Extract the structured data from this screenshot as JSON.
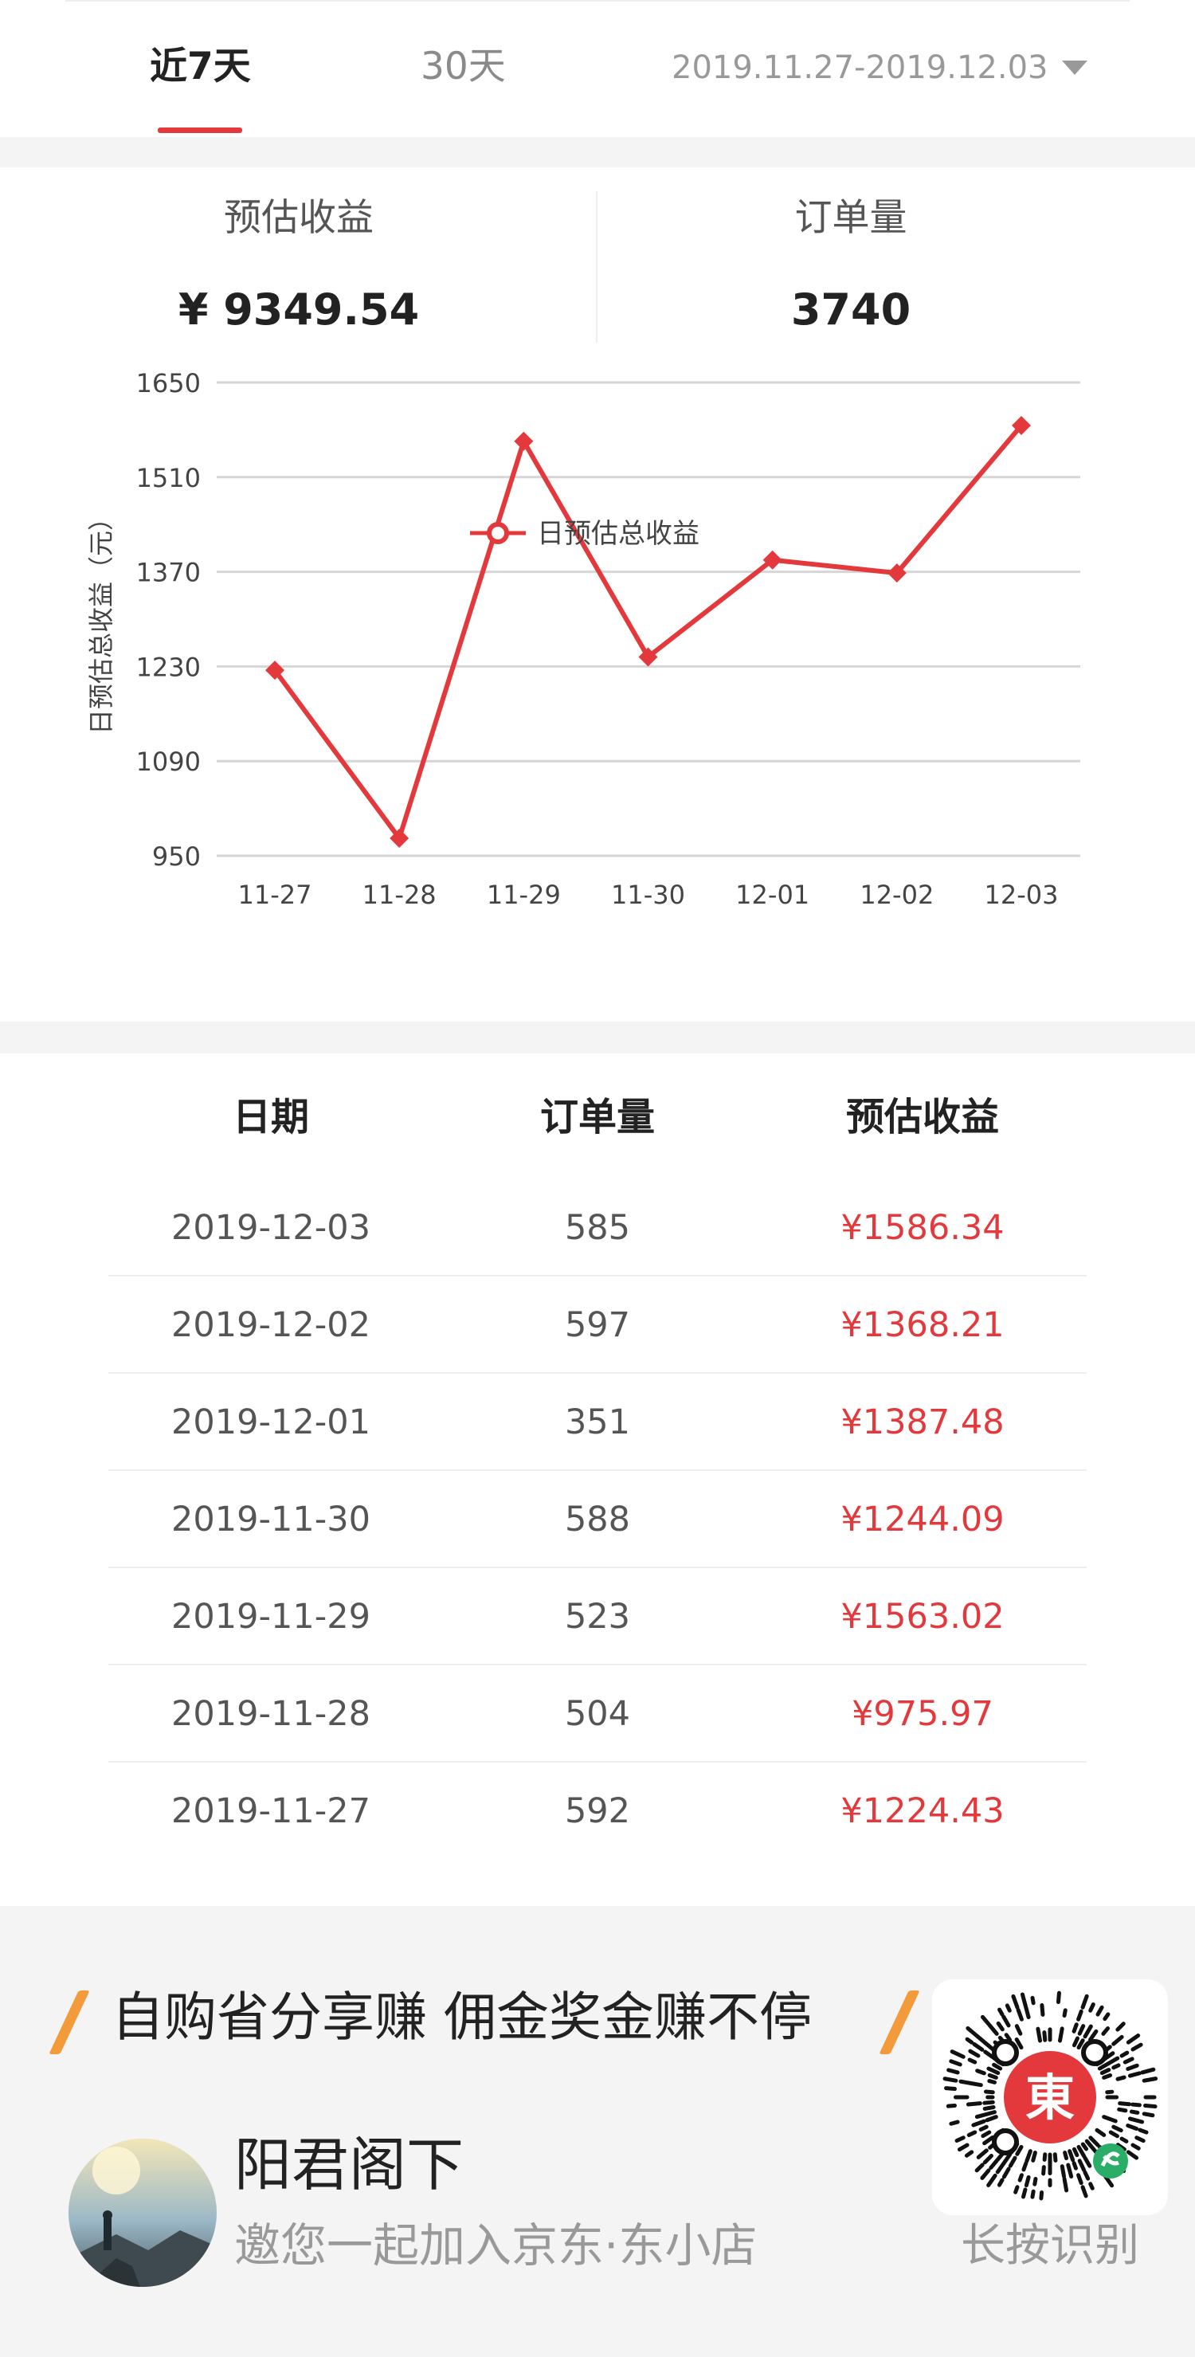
{
  "tabs": {
    "items": [
      {
        "label": "近7天",
        "active": true
      },
      {
        "label": "30天",
        "active": false
      }
    ],
    "date_range": "2019.11.27-2019.12.03"
  },
  "summary": {
    "earnings_label": "预估收益",
    "earnings_value": "¥ 9349.54",
    "orders_label": "订单量",
    "orders_value": "3740"
  },
  "chart_data": {
    "type": "line",
    "categories": [
      "11-27",
      "11-28",
      "11-29",
      "11-30",
      "12-01",
      "12-02",
      "12-03"
    ],
    "series": [
      {
        "name": "日预估总收益",
        "values": [
          1224.43,
          975.97,
          1563.02,
          1244.09,
          1387.48,
          1368.21,
          1586.34
        ],
        "color": "#e4393c"
      }
    ],
    "y_ticks": [
      "1650",
      "1510",
      "1370",
      "1230",
      "1090",
      "950"
    ],
    "ylabel": "日预估总收益（元）",
    "ylim": [
      950,
      1650
    ],
    "grid": true,
    "legend_position": "bottom-center"
  },
  "table": {
    "headers": {
      "date": "日期",
      "orders": "订单量",
      "earnings": "预估收益"
    },
    "rows": [
      {
        "date": "2019-12-03",
        "orders": "585",
        "earnings": "¥1586.34"
      },
      {
        "date": "2019-12-02",
        "orders": "597",
        "earnings": "¥1368.21"
      },
      {
        "date": "2019-12-01",
        "orders": "351",
        "earnings": "¥1387.48"
      },
      {
        "date": "2019-11-30",
        "orders": "588",
        "earnings": "¥1244.09"
      },
      {
        "date": "2019-11-29",
        "orders": "523",
        "earnings": "¥1563.02"
      },
      {
        "date": "2019-11-28",
        "orders": "504",
        "earnings": "¥975.97"
      },
      {
        "date": "2019-11-27",
        "orders": "592",
        "earnings": "¥1224.43"
      }
    ]
  },
  "promo": {
    "slogan": "自购省分享赚 佣金奖金赚不停",
    "user_name": "阳君阁下",
    "invite_text": "邀您一起加入京东·东小店",
    "qr_label": "长按识别",
    "qr_logo_char": "東"
  },
  "colors": {
    "accent_red": "#e4393c",
    "slash_orange": "#f39a3b",
    "wechat_green": "#2aae67"
  }
}
